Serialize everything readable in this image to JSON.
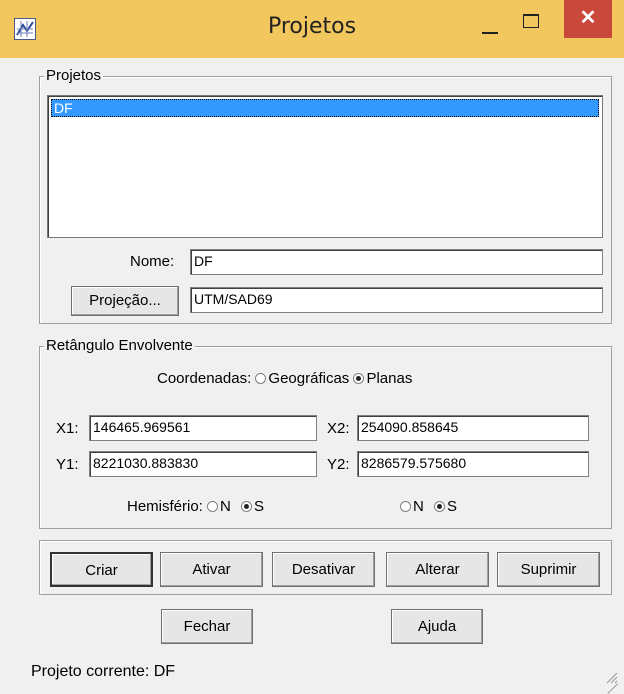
{
  "window": {
    "title": "Projetos"
  },
  "projetos": {
    "legend": "Projetos",
    "list_items": [
      "DF"
    ],
    "nome_label": "Nome:",
    "nome_value": "DF",
    "projecao_button": "Projeção...",
    "projecao_value": "UTM/SAD69"
  },
  "retangulo": {
    "legend": "Retângulo Envolvente",
    "coord_label": "Coordenadas:",
    "opt_geograficas": "Geográficas",
    "opt_planas": "Planas",
    "x1_label": "X1:",
    "x1_value": "146465.969561",
    "x2_label": "X2:",
    "x2_value": "254090.858645",
    "y1_label": "Y1:",
    "y1_value": "8221030.883830",
    "y2_label": "Y2:",
    "y2_value": "8286579.575680",
    "hemisferio_label": "Hemisfério:",
    "opt_n": "N",
    "opt_s": "S"
  },
  "actions": {
    "criar": "Criar",
    "ativar": "Ativar",
    "desativar": "Desativar",
    "alterar": "Alterar",
    "suprimir": "Suprimir",
    "fechar": "Fechar",
    "ajuda": "Ajuda"
  },
  "status": {
    "text": "Projeto corrente: DF"
  },
  "icons": {
    "close": "close-icon",
    "minimize": "minimize-icon",
    "maximize": "maximize-icon",
    "app": "app-icon"
  },
  "colors": {
    "titlebar": "#f2c85e",
    "close_button": "#c9483c",
    "selection": "#3399ff"
  }
}
